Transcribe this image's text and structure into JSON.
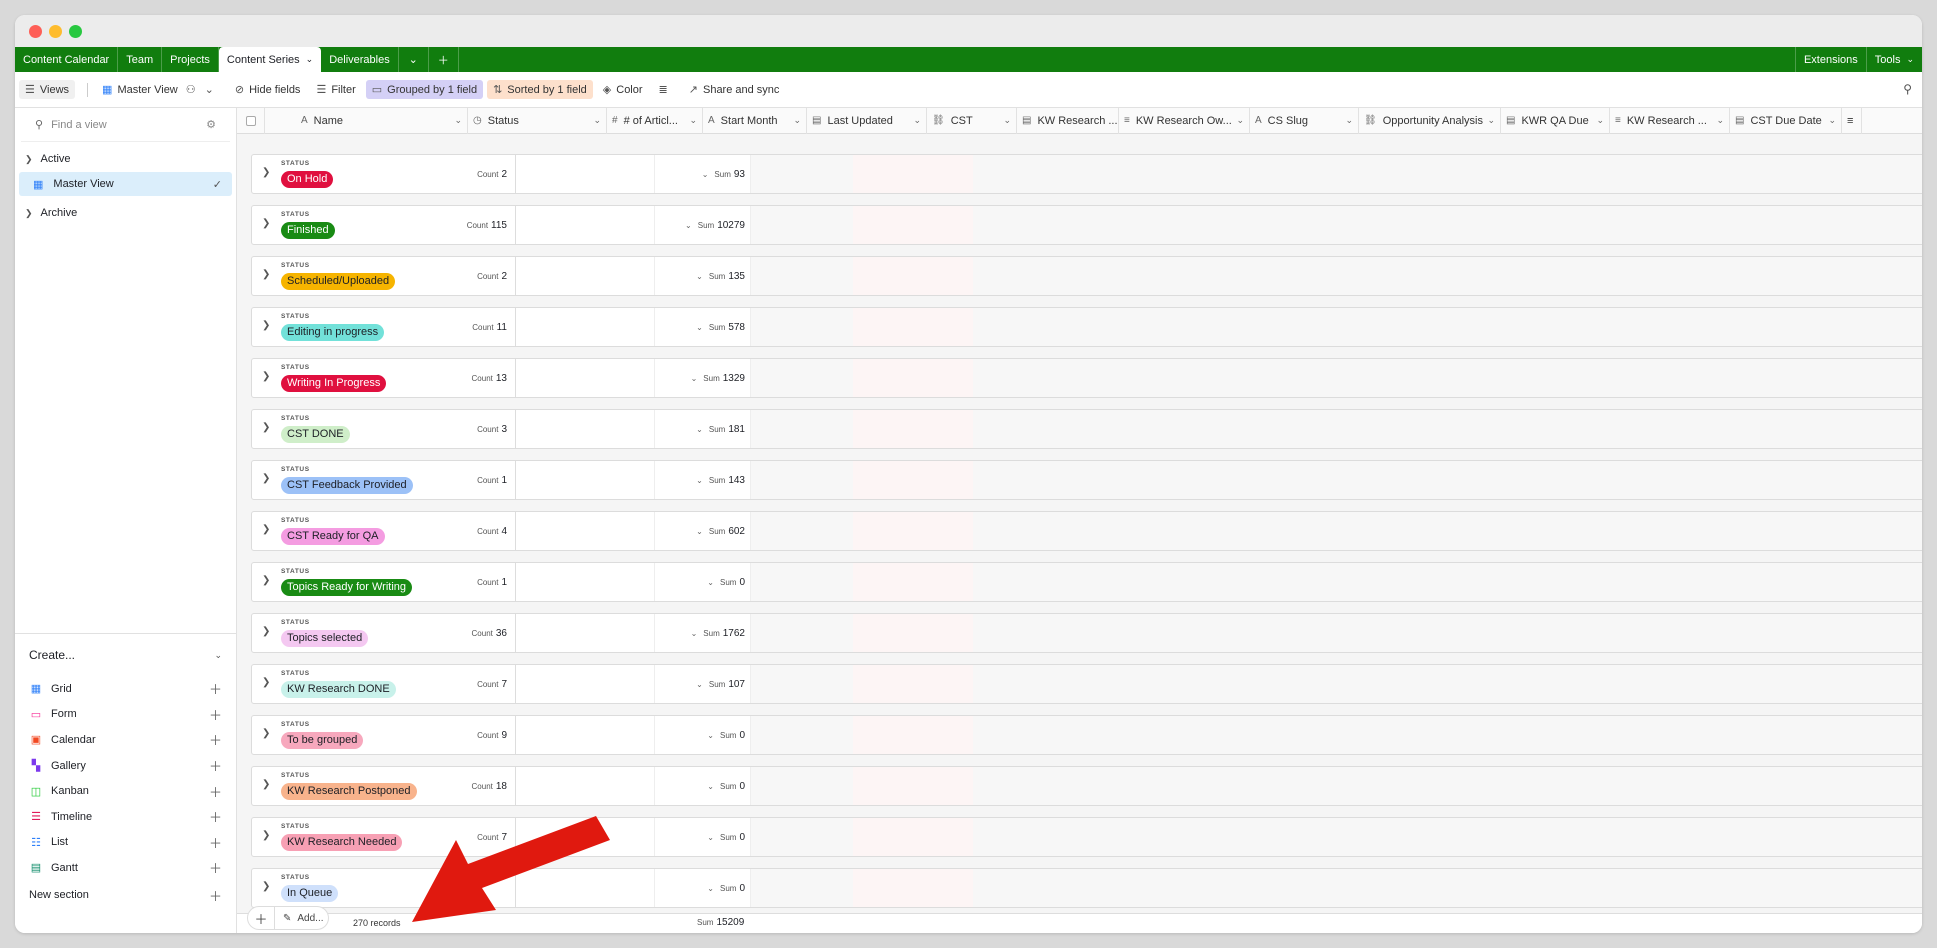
{
  "tabs": [
    {
      "label": "Content Calendar"
    },
    {
      "label": "Team"
    },
    {
      "label": "Projects"
    },
    {
      "label": "Content Series",
      "active": true
    },
    {
      "label": "Deliverables"
    }
  ],
  "tabbar_right": {
    "extensions": "Extensions",
    "tools": "Tools"
  },
  "toolbar": {
    "views": "Views",
    "view_name": "Master View",
    "hide_fields": "Hide fields",
    "filter": "Filter",
    "grouped": "Grouped by 1 field",
    "sorted": "Sorted by 1 field",
    "color": "Color",
    "share": "Share and sync"
  },
  "sidebar": {
    "search_placeholder": "Find a view",
    "sections": [
      {
        "label": "Active",
        "views": [
          {
            "label": "Master View",
            "selected": true
          }
        ]
      },
      {
        "label": "Archive",
        "views": []
      }
    ],
    "create_label": "Create...",
    "create_items": [
      {
        "label": "Grid",
        "icon": "grid-icon",
        "color": "#2d7ff9"
      },
      {
        "label": "Form",
        "icon": "form-icon",
        "color": "#f82b96"
      },
      {
        "label": "Calendar",
        "icon": "calendar-icon",
        "color": "#f24822"
      },
      {
        "label": "Gallery",
        "icon": "gallery-icon",
        "color": "#7c39ed"
      },
      {
        "label": "Kanban",
        "icon": "kanban-icon",
        "color": "#20c933"
      },
      {
        "label": "Timeline",
        "icon": "timeline-icon",
        "color": "#e01a5a"
      },
      {
        "label": "List",
        "icon": "list-icon",
        "color": "#2d7ff9"
      },
      {
        "label": "Gantt",
        "icon": "gantt-icon",
        "color": "#0f8c6a"
      }
    ],
    "new_section": "New section"
  },
  "columns": [
    {
      "label": "Name",
      "icon": "A"
    },
    {
      "label": "Status",
      "icon": "◷"
    },
    {
      "label": "# of Articl...",
      "icon": "#"
    },
    {
      "label": "Start Month",
      "icon": "A"
    },
    {
      "label": "Last Updated",
      "icon": "▤"
    },
    {
      "label": "CST",
      "icon": "⛓"
    },
    {
      "label": "KW Research ...",
      "icon": "▤"
    },
    {
      "label": "KW Research Ow...",
      "icon": "≡"
    },
    {
      "label": "CS Slug",
      "icon": "A"
    },
    {
      "label": "Opportunity Analysis",
      "icon": "⛓"
    },
    {
      "label": "KWR QA Due",
      "icon": "▤"
    },
    {
      "label": "KW Research ...",
      "icon": "≡"
    },
    {
      "label": "CST Due Date",
      "icon": "▤"
    }
  ],
  "group_label": "STATUS",
  "count_label": "Count",
  "sum_label": "Sum",
  "groups": [
    {
      "status": "On Hold",
      "bg": "#e0103f",
      "fg": "#ffffff",
      "count": "2",
      "sum": "93"
    },
    {
      "status": "Finished",
      "bg": "#198b14",
      "fg": "#ffffff",
      "count": "115",
      "sum": "10279"
    },
    {
      "status": "Scheduled/Uploaded",
      "bg": "#f6b400",
      "fg": "#1d1f25",
      "count": "2",
      "sum": "135"
    },
    {
      "status": "Editing in progress",
      "bg": "#72e1d9",
      "fg": "#1d1f25",
      "count": "11",
      "sum": "578"
    },
    {
      "status": "Writing In Progress",
      "bg": "#e0103f",
      "fg": "#ffffff",
      "count": "13",
      "sum": "1329"
    },
    {
      "status": "CST DONE",
      "bg": "#cfeec9",
      "fg": "#1d1f25",
      "count": "3",
      "sum": "181"
    },
    {
      "status": "CST Feedback Provided",
      "bg": "#9cc1f7",
      "fg": "#1d1f25",
      "count": "1",
      "sum": "143"
    },
    {
      "status": "CST Ready for QA",
      "bg": "#f49ce1",
      "fg": "#1d1f25",
      "count": "4",
      "sum": "602"
    },
    {
      "status": "Topics Ready for Writing",
      "bg": "#198b14",
      "fg": "#ffffff",
      "count": "1",
      "sum": "0"
    },
    {
      "status": "Topics selected",
      "bg": "#f4c8f1",
      "fg": "#1d1f25",
      "count": "36",
      "sum": "1762"
    },
    {
      "status": "KW Research DONE",
      "bg": "#c8f1ea",
      "fg": "#1d1f25",
      "count": "7",
      "sum": "107"
    },
    {
      "status": "To be grouped",
      "bg": "#f7a8bd",
      "fg": "#1d1f25",
      "count": "9",
      "sum": "0"
    },
    {
      "status": "KW Research Postponed",
      "bg": "#f8b38c",
      "fg": "#1d1f25",
      "count": "18",
      "sum": "0"
    },
    {
      "status": "KW Research Needed",
      "bg": "#f7a0b4",
      "fg": "#1d1f25",
      "count": "7",
      "sum": "0"
    },
    {
      "status": "In Queue",
      "bg": "#cfe0fb",
      "fg": "#1d1f25",
      "count": "",
      "sum": "0"
    }
  ],
  "footer": {
    "add_label": "Add...",
    "records": "270 records",
    "total_sum": "15209"
  },
  "colors": {
    "brand_green": "#117d0e",
    "annotation_arrow": "#e0190f"
  }
}
